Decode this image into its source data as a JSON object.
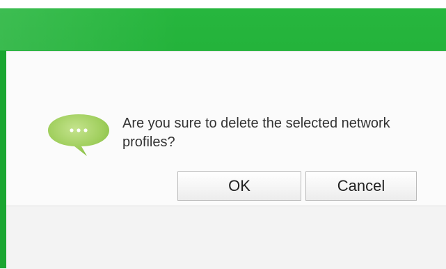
{
  "dialog": {
    "message": "Are you sure to delete the selected network profiles?",
    "icon": "chat-bubble-icon",
    "ok_label": "OK",
    "cancel_label": "Cancel"
  },
  "colors": {
    "header_green": "#1fae36",
    "bubble_green": "#9fce5c",
    "dialog_bg": "#fbfbfb"
  }
}
